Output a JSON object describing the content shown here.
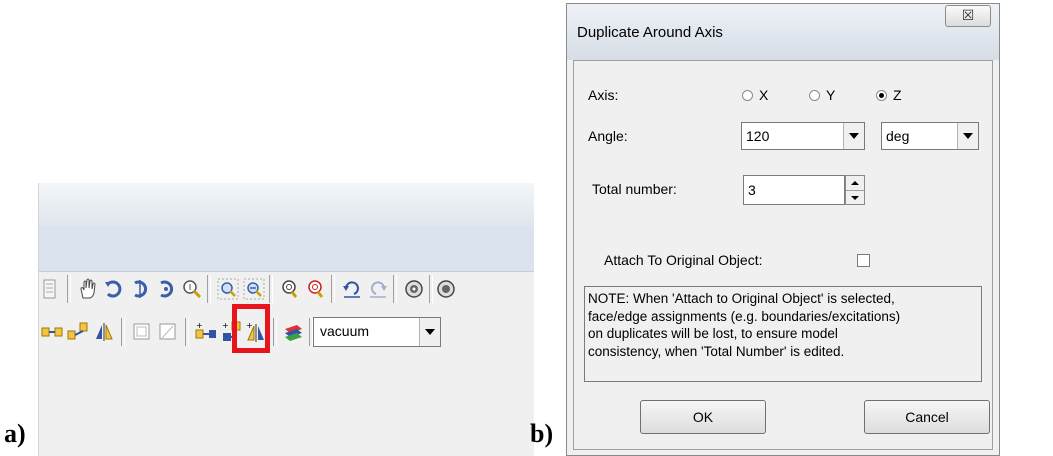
{
  "labels": {
    "panel_a": "a)",
    "panel_b": "b)"
  },
  "toolbar": {
    "row1_icons": [
      "page-icon",
      "hand-pan-icon",
      "rotate-icon",
      "rotate-about-axis-icon",
      "orient-icon",
      "zoom-icon",
      "zoom-in-icon",
      "zoom-out-icon",
      "fit-all-icon",
      "fit-selection-icon",
      "undo-icon",
      "redo-icon",
      "view-icon",
      "view-2-icon"
    ],
    "row2_icons": [
      "move-icon",
      "duplicate-along-line-icon",
      "mirror-icon",
      "sweep-icon",
      "sweep-2-icon",
      "duplicate-along-line-icon",
      "duplicate-around-axis-icon",
      "duplicate-mirror-icon",
      "material-icon"
    ],
    "material_value": "vacuum",
    "highlight_color": "#e8141c"
  },
  "dialog": {
    "title": "Duplicate Around Axis",
    "close_glyph": "☒",
    "axis_label": "Axis:",
    "axis_options": [
      "X",
      "Y",
      "Z"
    ],
    "axis_selected": "Z",
    "angle_label": "Angle:",
    "angle_value": "120",
    "angle_unit": "deg",
    "total_label": "Total number:",
    "total_value": "3",
    "attach_label": "Attach To Original Object:",
    "attach_checked": false,
    "note_lines": [
      "NOTE:  When 'Attach to Original Object' is selected,",
      "face/edge assignments (e.g. boundaries/excitations)",
      "on duplicates will be lost, to ensure model",
      "consistency, when 'Total Number' is edited."
    ],
    "ok_label": "OK",
    "cancel_label": "Cancel"
  }
}
